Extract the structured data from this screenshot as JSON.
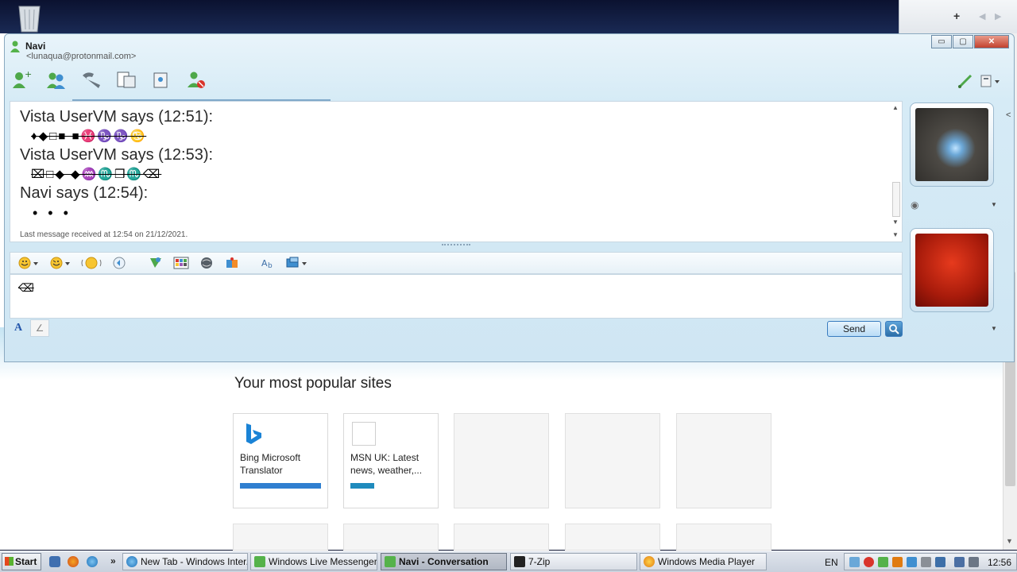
{
  "browser": {
    "popular_title": "Your most popular sites",
    "tiles": [
      {
        "label": "Bing Microsoft Translator",
        "bar_color": "#2f7fd0"
      },
      {
        "label": "MSN UK: Latest news, weather,...",
        "bar_color": "#1f8bbd"
      }
    ]
  },
  "messenger": {
    "contact_name": "Navi",
    "contact_email": "<lunaqua@protonmail.com>",
    "window_buttons": {
      "minimize": "▭",
      "maximize": "▢",
      "close": "✕"
    },
    "toolbar_icons": [
      "add-contact-icon",
      "invite-icon",
      "call-icon",
      "share-files-icon",
      "activities-icon",
      "block-icon"
    ],
    "conversation": [
      {
        "sender_line": "Vista UserVM says (12:51):",
        "message": "♦◆□■ ■♓♑♑♋"
      },
      {
        "sender_line": "Vista UserVM says (12:53):",
        "message": "⌧□◆ ◆♒♏❒♏⌫"
      },
      {
        "sender_line": "Navi says (12:54):",
        "message": "• • •"
      }
    ],
    "last_message": "Last message received at 12:54 on 21/12/2021.",
    "typed_message": "⌫",
    "send_label": "Send",
    "font_button": "A",
    "ink_button": "∠"
  },
  "taskbar": {
    "start_label": "Start",
    "tasks": [
      {
        "label": "New Tab - Windows Inter...",
        "active": false
      },
      {
        "label": "Windows Live Messenger",
        "active": false
      },
      {
        "label": "Navi - Conversation",
        "active": true
      },
      {
        "label": "7-Zip",
        "active": false
      },
      {
        "label": "Windows Media Player",
        "active": false
      }
    ],
    "overflow_chevron": "»",
    "language": "EN",
    "clock": "12:56"
  },
  "colors": {
    "accent": "#2f7fd0",
    "messenger_bg": "#d6ebf6",
    "taskbar_bg": "#d2d8e1"
  }
}
